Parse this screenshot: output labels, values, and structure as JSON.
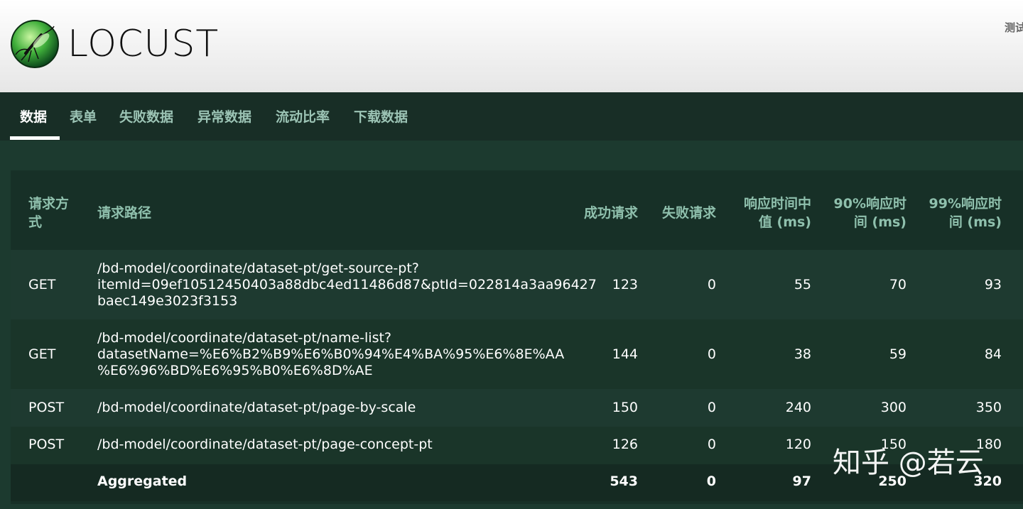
{
  "header": {
    "logo_text": "LOCUST",
    "host_text": "测试"
  },
  "tabs": [
    {
      "label": "数据",
      "active": true
    },
    {
      "label": "表单",
      "active": false
    },
    {
      "label": "失败数据",
      "active": false
    },
    {
      "label": "异常数据",
      "active": false
    },
    {
      "label": "流动比率",
      "active": false
    },
    {
      "label": "下载数据",
      "active": false
    }
  ],
  "table": {
    "headers": {
      "method_1": "请求方",
      "method_2": "式",
      "path": "请求路径",
      "success": "成功请求",
      "fail": "失败请求",
      "median_1": "响应时间中",
      "median_2": "值 (ms)",
      "p90_1": "90%响应时",
      "p90_2": "间 (ms)",
      "p99_1": "99%响应时",
      "p99_2": "间 (ms)"
    },
    "rows": [
      {
        "method": "GET",
        "path_lines": [
          "/bd-model/coordinate/dataset-pt/get-source-pt?",
          "itemId=09ef10512450403a88dbc4ed11486d87&ptId=022814a3aa96427",
          "baec149e3023f3153"
        ],
        "success": "123",
        "fail": "0",
        "median": "55",
        "p90": "70",
        "p99": "93"
      },
      {
        "method": "GET",
        "path_lines": [
          "/bd-model/coordinate/dataset-pt/name-list?",
          "datasetName=%E6%B2%B9%E6%B0%94%E4%BA%95%E6%8E%AA",
          "%E6%96%BD%E6%95%B0%E6%8D%AE"
        ],
        "success": "144",
        "fail": "0",
        "median": "38",
        "p90": "59",
        "p99": "84"
      },
      {
        "method": "POST",
        "path_lines": [
          "/bd-model/coordinate/dataset-pt/page-by-scale"
        ],
        "success": "150",
        "fail": "0",
        "median": "240",
        "p90": "300",
        "p99": "350"
      },
      {
        "method": "POST",
        "path_lines": [
          "/bd-model/coordinate/dataset-pt/page-concept-pt"
        ],
        "success": "126",
        "fail": "0",
        "median": "120",
        "p90": "150",
        "p99": "180"
      }
    ],
    "aggregate": {
      "label": "Aggregated",
      "success": "543",
      "fail": "0",
      "median": "97",
      "p90": "250",
      "p99": "320"
    }
  },
  "watermark": "知乎 @若云"
}
